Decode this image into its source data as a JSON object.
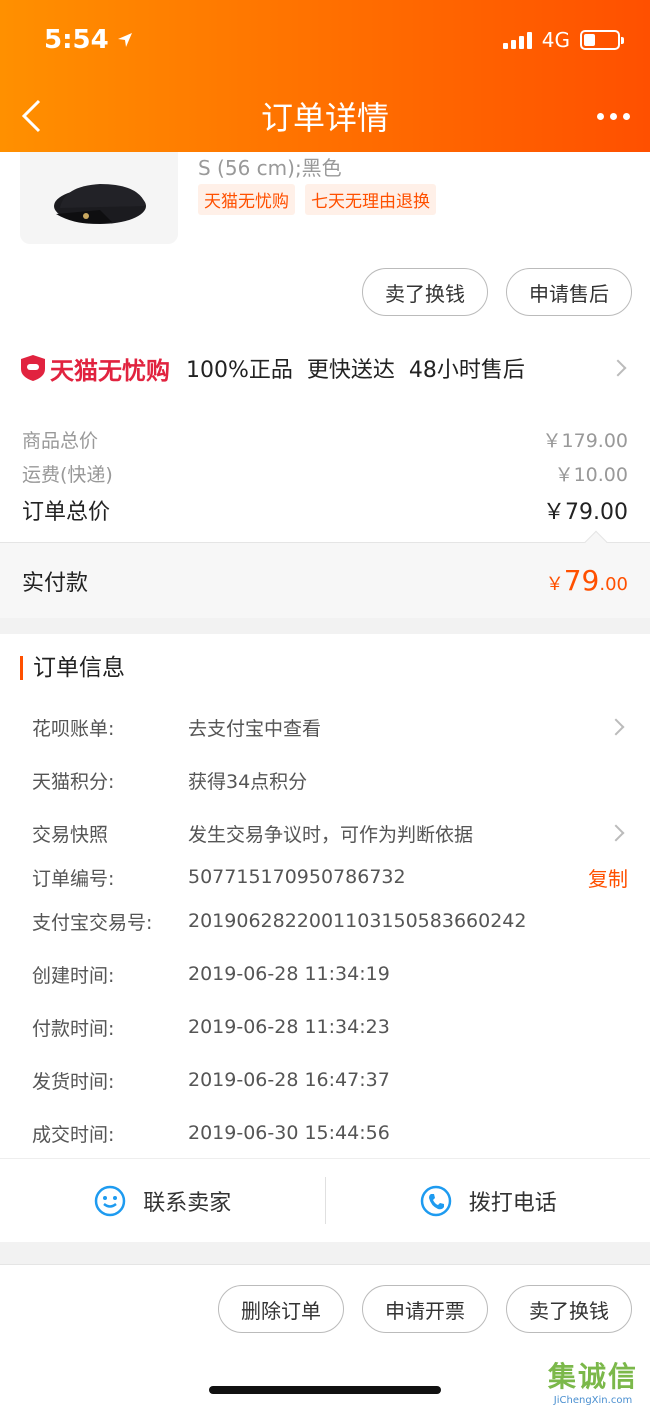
{
  "status": {
    "time": "5:54",
    "network": "4G"
  },
  "nav": {
    "title": "订单详情"
  },
  "product": {
    "spec": "S (56 cm);黑色",
    "tags": [
      "天猫无忧购",
      "七天无理由退换"
    ],
    "actions": [
      "卖了换钱",
      "申请售后"
    ]
  },
  "guarantee": {
    "brand": "天猫无忧购",
    "points": [
      "100%正品",
      "更快送达",
      "48小时售后"
    ]
  },
  "price": {
    "goods_label": "商品总价",
    "goods_value": "￥179.00",
    "shipping_label": "运费(快递)",
    "shipping_value": "￥10.00",
    "total_label": "订单总价",
    "total_value": "￥79.00",
    "paid_label": "实付款",
    "paid_currency": "￥",
    "paid_int": "79",
    "paid_dec": ".00"
  },
  "order_info": {
    "title": "订单信息",
    "rows": [
      {
        "key": "花呗账单:",
        "value": "去支付宝中查看"
      },
      {
        "key": "天猫积分:",
        "value": "获得34点积分"
      },
      {
        "key": "交易快照",
        "value": "发生交易争议时，可作为判断依据"
      },
      {
        "key": "订单编号:",
        "value": "507715170950786732",
        "action": "复制"
      },
      {
        "key": "支付宝交易号:",
        "value": "2019062822001103150583660242"
      },
      {
        "key": "创建时间:",
        "value": "2019-06-28 11:34:19"
      },
      {
        "key": "付款时间:",
        "value": "2019-06-28 11:34:23"
      },
      {
        "key": "发货时间:",
        "value": "2019-06-28 16:47:37"
      },
      {
        "key": "成交时间:",
        "value": "2019-06-30 15:44:56"
      }
    ]
  },
  "contact": {
    "seller": "联系卖家",
    "phone": "拨打电话"
  },
  "bottom_actions": [
    "删除订单",
    "申请开票",
    "卖了换钱"
  ],
  "watermark": {
    "text": "集诚信",
    "sub": "JiChengXin.com"
  },
  "colors": {
    "accent": "#ff5000",
    "tmall": "#e1233f",
    "header_from": "#ff9000",
    "header_to": "#ff5000"
  }
}
